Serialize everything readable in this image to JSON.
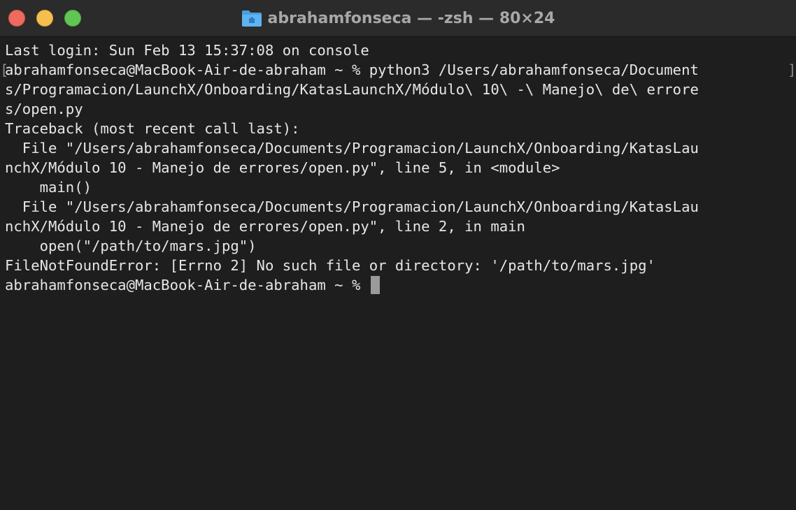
{
  "window": {
    "title": "abrahamfonseca — -zsh — 80×24",
    "folder_icon": "home-folder-icon"
  },
  "terminal": {
    "lines": [
      "Last login: Sun Feb 13 15:37:08 on console",
      "abrahamfonseca@MacBook-Air-de-abraham ~ % python3 /Users/abrahamfonseca/Document",
      "s/Programacion/LaunchX/Onboarding/KatasLaunchX/Módulo\\ 10\\ -\\ Manejo\\ de\\ errore",
      "s/open.py",
      "Traceback (most recent call last):",
      "  File \"/Users/abrahamfonseca/Documents/Programacion/LaunchX/Onboarding/KatasLau",
      "nchX/Módulo 10 - Manejo de errores/open.py\", line 5, in <module>",
      "    main()",
      "  File \"/Users/abrahamfonseca/Documents/Programacion/LaunchX/Onboarding/KatasLau",
      "nchX/Módulo 10 - Manejo de errores/open.py\", line 2, in main",
      "    open(\"/path/to/mars.jpg\")",
      "FileNotFoundError: [Errno 2] No such file or directory: '/path/to/mars.jpg'",
      "abrahamfonseca@MacBook-Air-de-abraham ~ % "
    ]
  },
  "colors": {
    "background": "#1e1e1e",
    "titlebar": "#2b2b2b",
    "text": "#e6e6e6",
    "cursor": "#9a9a9a"
  }
}
